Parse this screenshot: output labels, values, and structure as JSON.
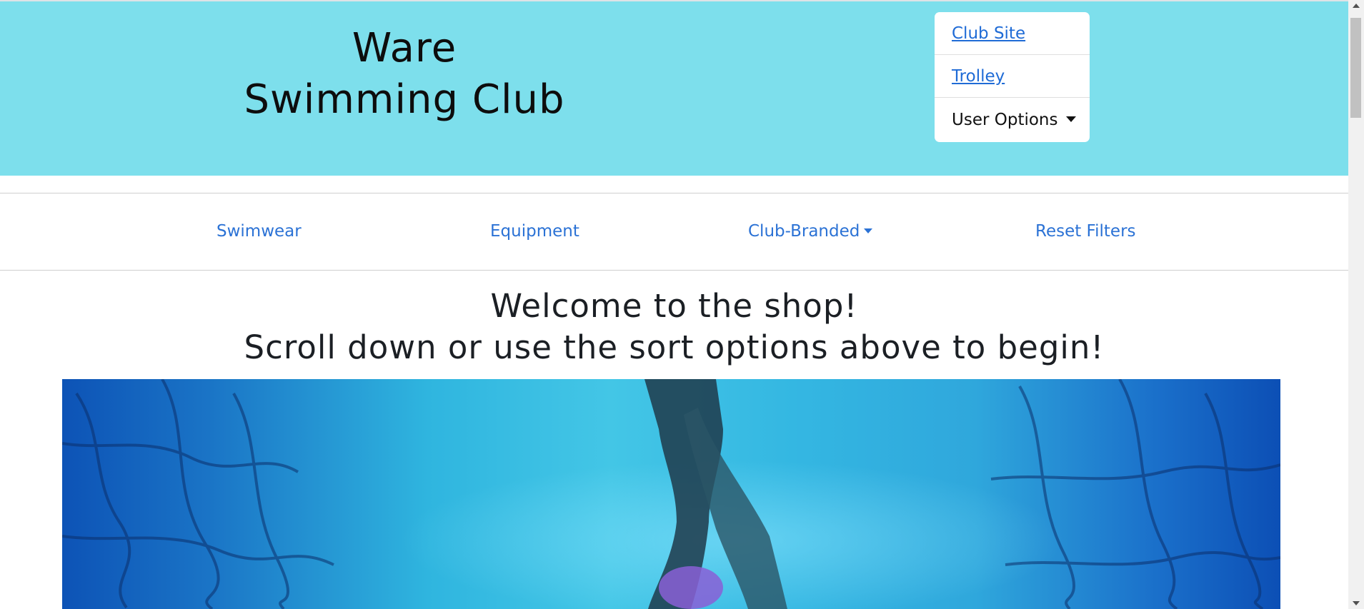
{
  "header": {
    "title_line1": "Ware",
    "title_line2": "Swimming Club",
    "background_color": "#7ddfec"
  },
  "user_menu": {
    "club_site": "Club Site",
    "trolley": "Trolley",
    "user_options": "User Options"
  },
  "nav": {
    "swimwear": "Swimwear",
    "equipment": "Equipment",
    "club_branded": "Club-Branded",
    "reset_filters": "Reset Filters",
    "link_color": "#2b72d5"
  },
  "welcome": {
    "line1": "Welcome to the shop!",
    "line2": "Scroll down or use the sort options above to begin!"
  },
  "hero": {
    "image": "underwater-swimmer-pool"
  }
}
